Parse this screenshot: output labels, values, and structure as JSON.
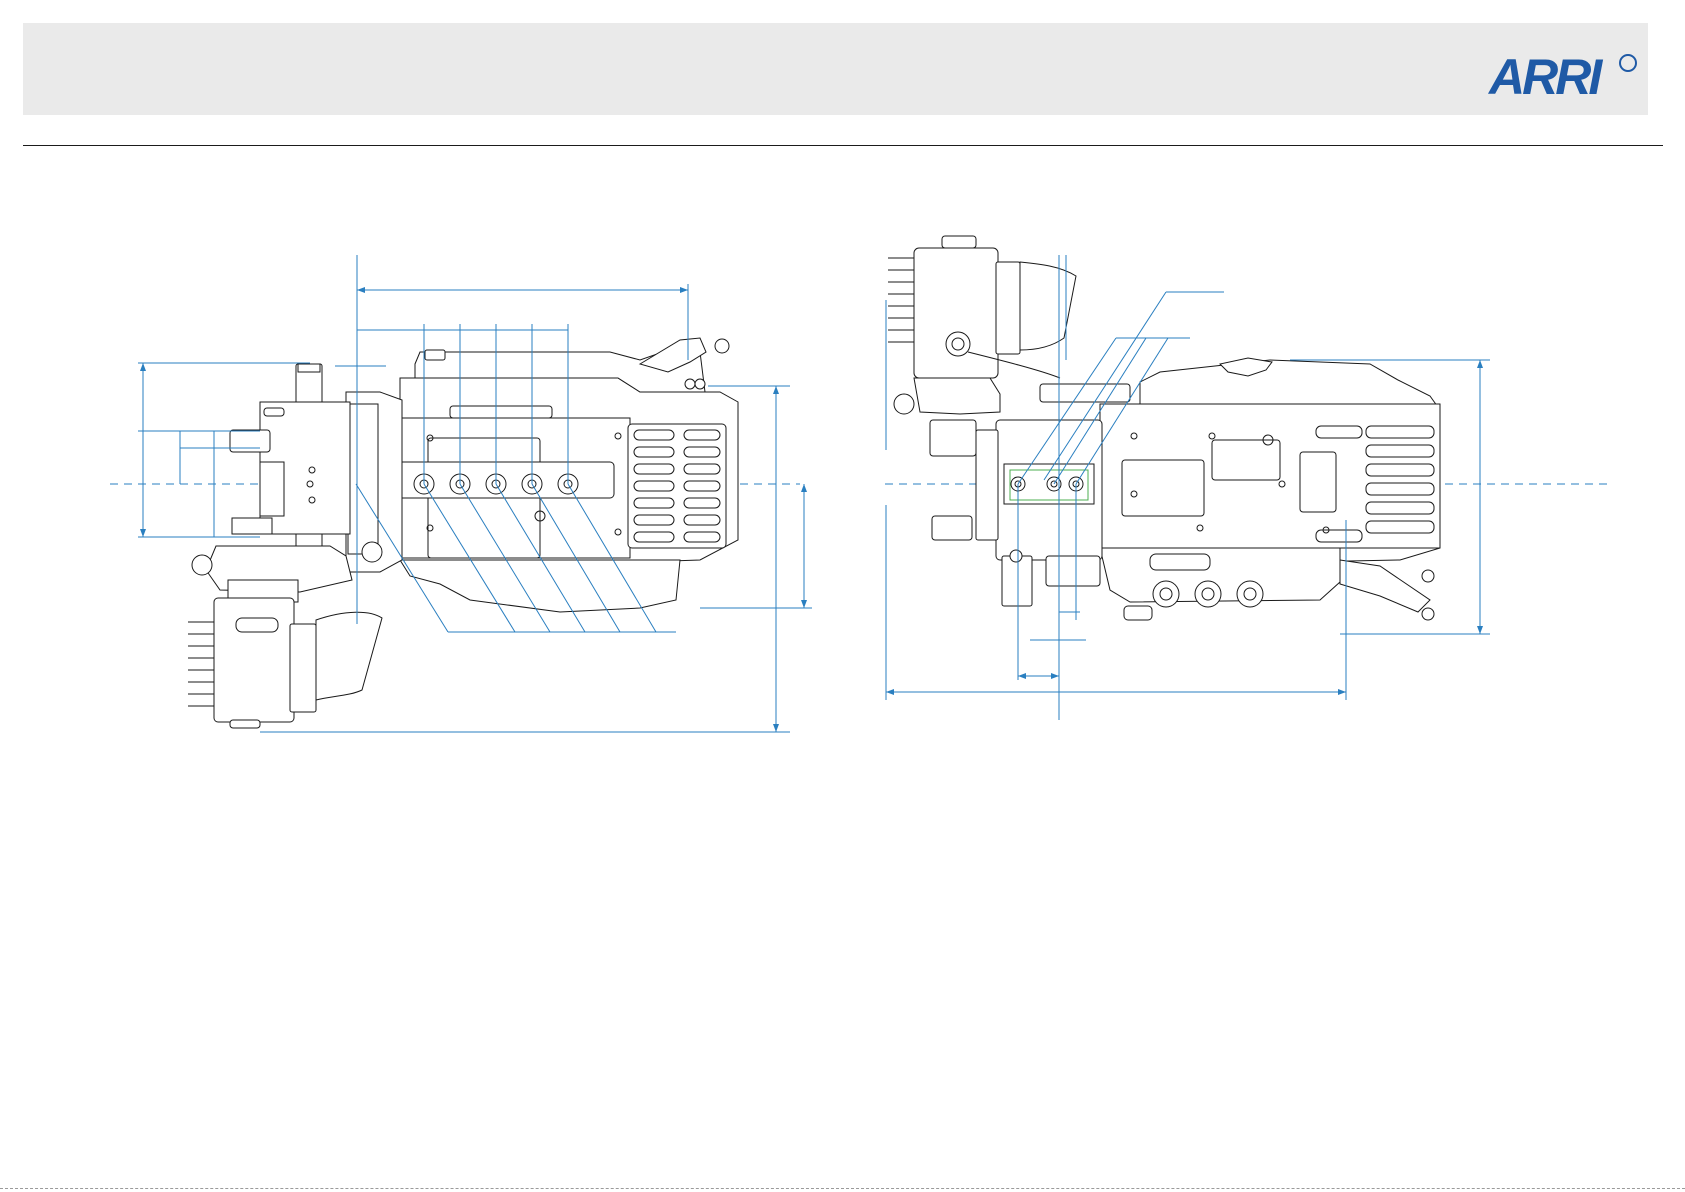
{
  "brand": {
    "logo_text": "ARRI",
    "accent_color": "#1f5aa6",
    "dimension_line_color": "#2a7fc0",
    "highlight_color": "#4caf50"
  },
  "header": {
    "band_color": "#eaeaea",
    "rule_color": "#1b1b1b"
  },
  "views": [
    {
      "name": "camera-left-side-view"
    },
    {
      "name": "camera-bottom-view"
    }
  ]
}
